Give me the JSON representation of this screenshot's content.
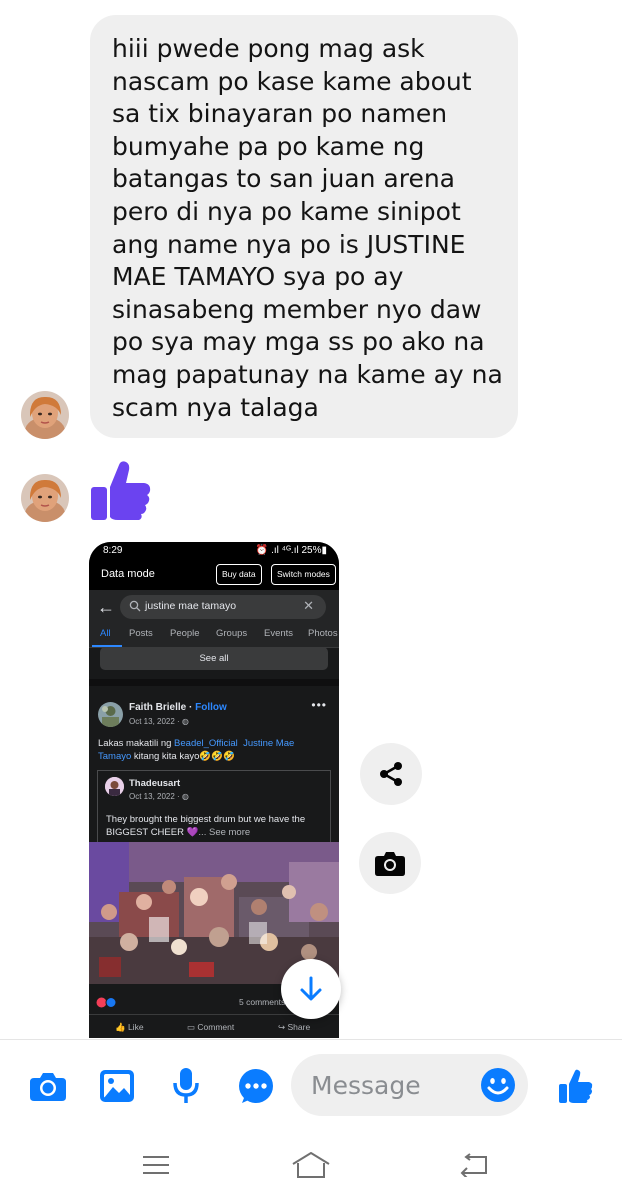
{
  "chat": {
    "message_lines": [
      "hiii pwede pong mag ask",
      "nascam po kase kame about",
      "sa tix binayaran po namen",
      "bumyahe pa po kame ng",
      "batangas to san juan arena",
      "pero di nya po kame sinipot",
      "ang name nya po is JUSTINE",
      "MAE TAMAYO sya po ay",
      "sinasabeng member nyo daw",
      "po sya may mga ss po ako na",
      "mag papatunay na kame ay na",
      "scam nya talaga"
    ],
    "sticker": "thumbs-up-icon"
  },
  "shared_screenshot": {
    "status_time": "8:29",
    "status_right": "⏰ .ıl ⁴ᴳ.ıl 25%▮",
    "data_mode_label": "Data mode",
    "buy_data_label": "Buy data",
    "switch_modes_label": "Switch modes",
    "search_value": "justine mae tamayo",
    "tabs": [
      "All",
      "Posts",
      "People",
      "Groups",
      "Events",
      "Photos"
    ],
    "see_all": "See all",
    "post": {
      "author": "Faith Brielle",
      "follow": "Follow",
      "date": "Oct 13, 2022 · ",
      "text_prefix": "Lakas makatili ng ",
      "mention_1": "Beadel_Official",
      "mention_2_a": "Justine Mae",
      "mention_2_b": "Tamayo",
      "text_suffix": " kitang kita kayo🤣🤣🤣",
      "quoted_author": "Thadeusart",
      "quoted_date": "Oct 13, 2022 · ",
      "quoted_text": "They brought the biggest drum but we have the BIGGEST CHEER 💜",
      "see_more": "... See more",
      "comments": "5 comments",
      "like": "Like",
      "comment": "Comment",
      "share": "Share"
    }
  },
  "composer": {
    "placeholder": "Message"
  },
  "colors": {
    "accent": "#0a7cff",
    "bubble": "#efefef",
    "sticker": "#6b43f0"
  }
}
